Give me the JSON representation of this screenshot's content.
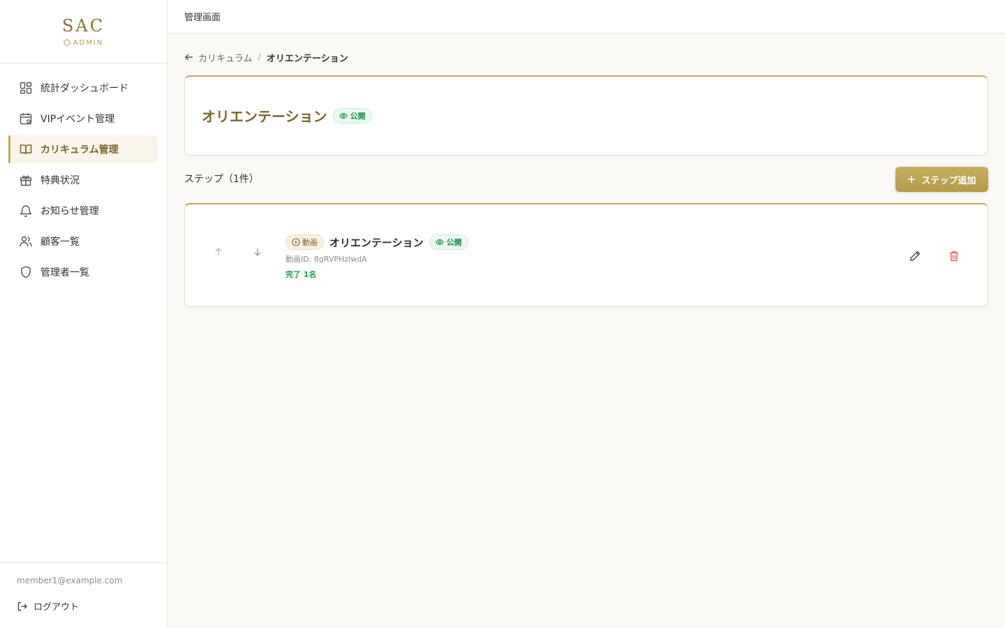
{
  "sidebar": {
    "logo_title": "SAC",
    "logo_sub": "ADMIN",
    "items": [
      {
        "label": "統計ダッシュボード",
        "icon": "dashboard-icon"
      },
      {
        "label": "VIPイベント管理",
        "icon": "calendar-icon"
      },
      {
        "label": "カリキュラム管理",
        "icon": "book-icon",
        "active": true
      },
      {
        "label": "特典状況",
        "icon": "gift-icon"
      },
      {
        "label": "お知らせ管理",
        "icon": "bell-icon"
      },
      {
        "label": "顧客一覧",
        "icon": "users-icon"
      },
      {
        "label": "管理者一覧",
        "icon": "shield-icon"
      }
    ],
    "user_email": "member1@example.com",
    "logout_label": "ログアウト"
  },
  "header": {
    "title": "管理画面"
  },
  "breadcrumb": {
    "parent": "カリキュラム",
    "separator": "/",
    "current": "オリエンテーション"
  },
  "curriculum": {
    "title": "オリエンテーション",
    "status": "公開"
  },
  "steps": {
    "header": "ステップ（1件）",
    "add_label": "ステップ追加",
    "items": [
      {
        "type": "動画",
        "title": "オリエンテーション",
        "status": "公開",
        "video_id": "動画ID: 8gRVPHzlwdA",
        "completed": "完了 1名"
      }
    ]
  },
  "colors": {
    "accent": "#c4a75a",
    "accent_dark": "#7a6430",
    "public_green": "#1f8a4c",
    "delete_red": "#e25a5a",
    "background": "#faf9f6"
  }
}
